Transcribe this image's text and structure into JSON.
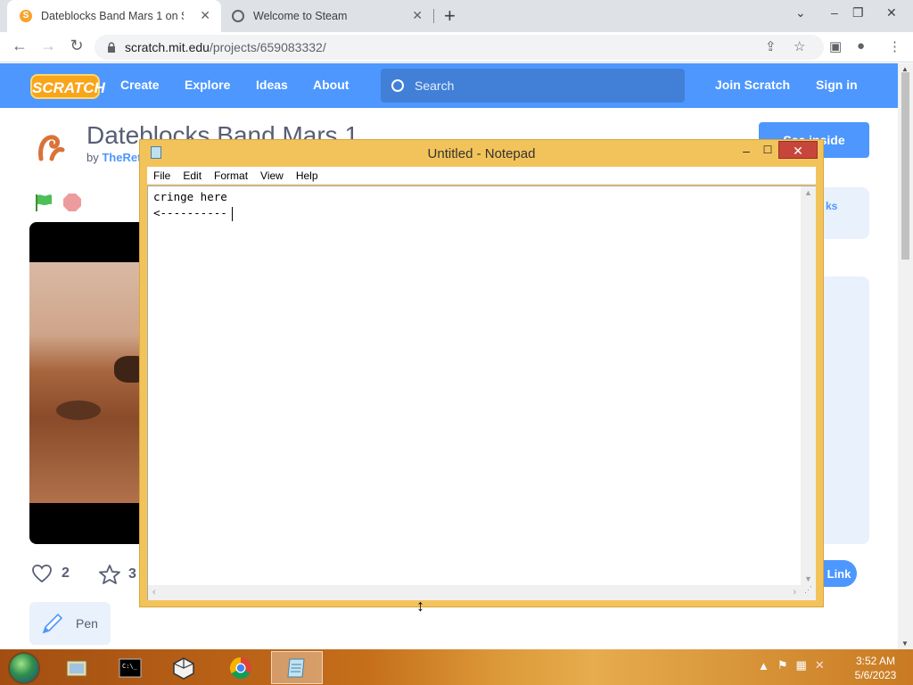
{
  "browser": {
    "tabs": [
      {
        "title": "Dateblocks Band Mars 1 on Scratch",
        "active": true
      },
      {
        "title": "Welcome to Steam",
        "active": false
      }
    ],
    "url_host": "scratch.mit.edu",
    "url_path": "/projects/659083332/"
  },
  "scratch": {
    "logo": "SCRATCH",
    "nav": {
      "create": "Create",
      "explore": "Explore",
      "ideas": "Ideas",
      "about": "About"
    },
    "search_placeholder": "Search",
    "join": "Join Scratch",
    "signin": "Sign in",
    "project_title": "Dateblocks Band Mars 1",
    "author_prefix": "by",
    "author": "TheRet",
    "see_inside": "See inside",
    "panel_fragment": "ks",
    "copy_link_fragment": "Link",
    "loves": "2",
    "favorites": "3",
    "extension_tag": "Pen"
  },
  "notepad": {
    "title": "Untitled - Notepad",
    "menus": [
      "File",
      "Edit",
      "Format",
      "View",
      "Help"
    ],
    "text": "cringe here\n<----------"
  },
  "taskbar": {
    "time": "3:52 AM",
    "date": "5/6/2023"
  },
  "colors": {
    "scratch_blue": "#4d97ff",
    "notepad_frame": "#f3c35b",
    "close_red": "#c7463c"
  }
}
